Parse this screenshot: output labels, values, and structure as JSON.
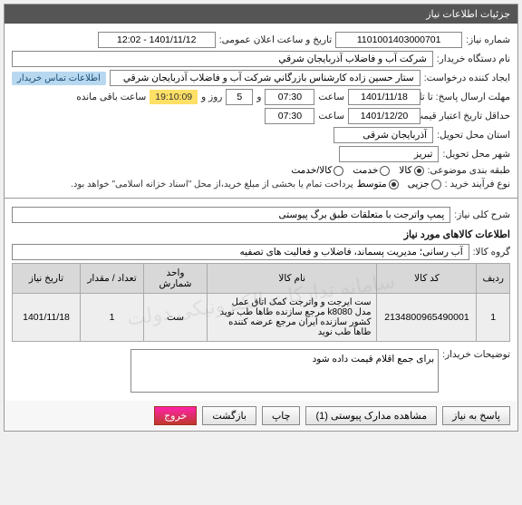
{
  "header": {
    "title": "جزئیات اطلاعات نیاز"
  },
  "info": {
    "need_number_label": "شماره نیاز:",
    "need_number": "1101001403000701",
    "announce_label": "تاریخ و ساعت اعلان عمومی:",
    "announce_value": "1401/11/12 - 12:02",
    "buyer_org_label": "نام دستگاه خریدار:",
    "buyer_org": "شرکت آب و فاضلاب آذربايجان شرقي",
    "requester_label": "ایجاد کننده درخواست:",
    "requester": "ستار حسين زاده كارشناس بازرگاني شرکت آب و فاضلاب آذربايجان شرقي",
    "buyer_contact_badge": "اطلاعات تماس خریدار",
    "reply_deadline_label": "مهلت ارسال پاسخ: تا تاریخ:",
    "reply_date": "1401/11/18",
    "time_label": "ساعت",
    "reply_time": "07:30",
    "and_label": "و",
    "days": "5",
    "days_label": "روز و",
    "remaining_time": "19:10:09",
    "remaining_label": "ساعت باقی مانده",
    "price_validity_label": "حداقل تاریخ اعتبار قیمت: تا تاریخ:",
    "price_date": "1401/12/20",
    "price_time": "07:30",
    "province_label": "استان محل تحویل:",
    "province": "آذربایجان شرقی",
    "city_label": "شهر محل تحویل:",
    "city": "تبریز",
    "category_label": "طبقه بندی موضوعی:",
    "cat_goods": "کالا",
    "cat_service": "خدمت",
    "cat_both": "کالا/خدمت",
    "purchase_type_label": "نوع فرآیند خرید :",
    "pt_small": "جزیی",
    "pt_medium": "متوسط",
    "pt_note": "پرداخت تمام یا بخشی از مبلغ خرید،از محل \"اسناد خزانه اسلامی\" خواهد بود."
  },
  "desc": {
    "need_desc_label": "شرح کلی نیاز:",
    "need_desc": "پمپ واترجت با متعلقات طبق برگ پیوستی",
    "items_info_title": "اطلاعات کالاهای مورد نیاز",
    "group_label": "گروه کالا:",
    "group_value": "آب رسانی؛ مدیریت پسماند، فاضلاب و فعالیت های تصفیه"
  },
  "table": {
    "headers": [
      "ردیف",
      "کد کالا",
      "نام کالا",
      "واحد شمارش",
      "تعداد / مقدار",
      "تاریخ نیاز"
    ],
    "rows": [
      {
        "idx": "1",
        "code": "2134800965490001",
        "name": "ست ایرجت و واترجت کمک اتاق عمل مدل k8080 مرجع سازنده طاها طب نوید کشور سازنده ایران مرجع عرضه کننده طاها طب نوید",
        "unit": "ست",
        "qty": "1",
        "date": "1401/11/18"
      }
    ]
  },
  "notes": {
    "buyer_notes_label": "توضیحات خریدار:",
    "buyer_notes": "برای جمع اقلام قیمت داده شود"
  },
  "footer": {
    "reply": "پاسخ به نیاز",
    "attachments": "مشاهده مدارک پیوستی (1)",
    "print": "چاپ",
    "back": "بازگشت",
    "exit": "خروج"
  }
}
